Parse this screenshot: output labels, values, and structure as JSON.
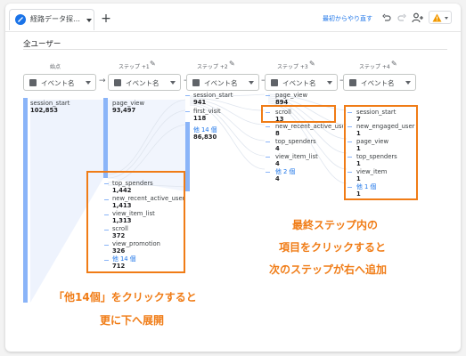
{
  "tab": {
    "title": "経路データ探…"
  },
  "toolbar": {
    "reset_label": "最初からやり直す"
  },
  "segment": {
    "label": "全ユーザー"
  },
  "steps": [
    {
      "label": "始点",
      "dimension": "イベント名"
    },
    {
      "label": "ステップ +1",
      "dimension": "イベント名"
    },
    {
      "label": "ステップ +2",
      "dimension": "イベント名"
    },
    {
      "label": "ステップ +3",
      "dimension": "イベント名"
    },
    {
      "label": "ステップ +4",
      "dimension": "イベント名"
    }
  ],
  "col0": {
    "items": [
      {
        "name": "session_start",
        "value": "102,853"
      }
    ]
  },
  "col1": {
    "main": {
      "name": "page_view",
      "value": "93,497"
    },
    "items": [
      {
        "name": "top_spenders",
        "value": "1,442"
      },
      {
        "name": "new_recent_active_user",
        "value": "1,413"
      },
      {
        "name": "view_item_list",
        "value": "1,313"
      },
      {
        "name": "scroll",
        "value": "372"
      },
      {
        "name": "view_promotion",
        "value": "326"
      },
      {
        "name": "他 14 個",
        "value": "712"
      }
    ]
  },
  "col2": {
    "items": [
      {
        "name": "session_start",
        "value": "941"
      },
      {
        "name": "first_visit",
        "value": "118"
      },
      {
        "name": "他 14 個",
        "value": "86,830"
      }
    ]
  },
  "col3": {
    "items": [
      {
        "name": "page_view",
        "value": "894"
      },
      {
        "name": "scroll",
        "value": "13"
      },
      {
        "name": "new_recent_active_user",
        "value": "8"
      },
      {
        "name": "top_spenders",
        "value": "4"
      },
      {
        "name": "view_item_list",
        "value": "4"
      },
      {
        "name": "他 2 個",
        "value": "4"
      }
    ]
  },
  "col4": {
    "items": [
      {
        "name": "session_start",
        "value": "7"
      },
      {
        "name": "new_engaged_user",
        "value": "1"
      },
      {
        "name": "page_view",
        "value": "1"
      },
      {
        "name": "top_spenders",
        "value": "1"
      },
      {
        "name": "view_item",
        "value": "1"
      },
      {
        "name": "他 1 個",
        "value": "1"
      }
    ]
  },
  "annotations": {
    "right": [
      "最終ステップ内の",
      "項目をクリックすると",
      "次のステップが右へ追加"
    ],
    "left": [
      "「他14個」をクリックすると",
      "更に下へ展開"
    ]
  },
  "colors": {
    "accent": "#f07c16",
    "bar": "#8ab4f8",
    "link": "#1a73e8",
    "logo": "#1a73e8",
    "warning": "#f29900"
  }
}
